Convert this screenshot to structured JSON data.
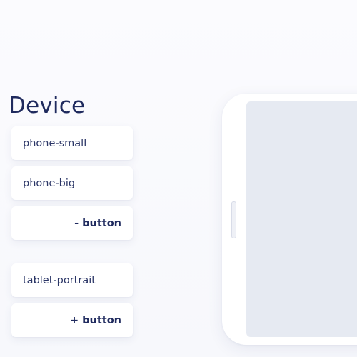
{
  "heading": "Device",
  "options": {
    "phone_small": "phone-small",
    "phone_big": "phone-big",
    "minus_button": "- button",
    "tablet_portrait": "tablet-portrait",
    "plus_button": "+ button"
  },
  "colors": {
    "text_primary": "#1f2a5e",
    "screen": "#e6eaf2",
    "card": "#ffffff"
  }
}
